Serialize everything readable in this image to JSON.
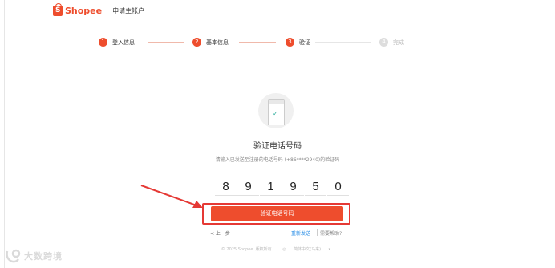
{
  "header": {
    "brand_icon_letter": "S",
    "brand_name": "Shopee",
    "title": "申请主帐户"
  },
  "stepper": {
    "steps": [
      {
        "num": "1",
        "label": "登入信息",
        "state": "done"
      },
      {
        "num": "2",
        "label": "基本信息",
        "state": "done"
      },
      {
        "num": "3",
        "label": "验证",
        "state": "active"
      },
      {
        "num": "4",
        "label": "完成",
        "state": "pending"
      }
    ]
  },
  "main": {
    "title": "验证电话号码",
    "description": "请输入已发送至注册的电话号码 (+86****2940)的验证码",
    "code_digits": [
      "8",
      "9",
      "1",
      "9",
      "5",
      "0"
    ],
    "verify_button": "验证电话号码",
    "back_link": "< 上一步",
    "resend_link": "重新发送",
    "help_link": "需要帮助?"
  },
  "footer": {
    "copyright": "© 2025 Shopee. 版权所有",
    "language": "简体中文(马来)"
  },
  "watermark": {
    "text": "大数跨境"
  },
  "colors": {
    "accent": "#ee4d2d",
    "annotation": "#e53935",
    "link": "#1e88e5"
  }
}
